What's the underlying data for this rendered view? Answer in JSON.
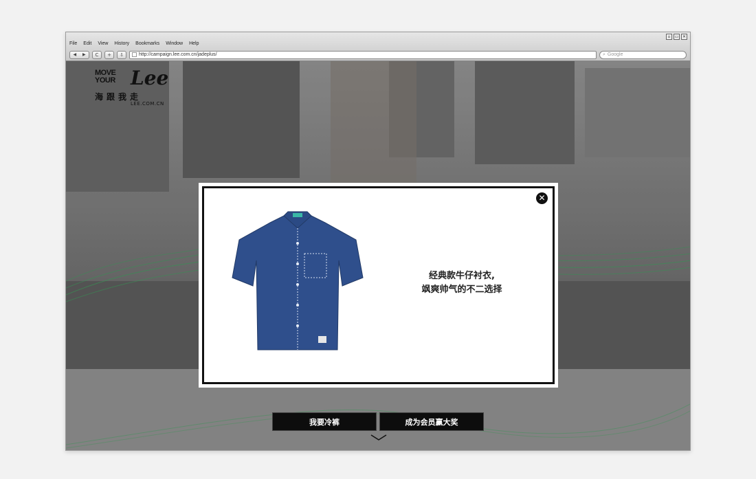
{
  "browser": {
    "menu": [
      "File",
      "Edit",
      "View",
      "History",
      "Bookmarks",
      "Window",
      "Help"
    ],
    "url": "http://campaign.lee.com.cn/jadeplus/",
    "search_placeholder": "Google",
    "nav": {
      "back": "◀",
      "forward": "▶",
      "reload": "C",
      "add": "+",
      "downloads": "⇩"
    },
    "window_buttons": [
      "▫",
      "▭",
      "✕"
    ]
  },
  "logo": {
    "line1": "MOVE",
    "line2": "YOUR",
    "brand": "Lee",
    "cn": "海跟我走",
    "site": "LEE.COM.CN"
  },
  "modal": {
    "close_icon": "close-icon",
    "caption_line1": "经典款牛仔衬衣,",
    "caption_line2": "飒爽帅气的不二选择"
  },
  "cta": {
    "primary": "我要冷裤",
    "secondary": "成为会员赢大奖"
  },
  "colors": {
    "accent_green": "#3c9a5a",
    "shirt_denim": "#2f4f8c",
    "modal_border": "#111111"
  }
}
